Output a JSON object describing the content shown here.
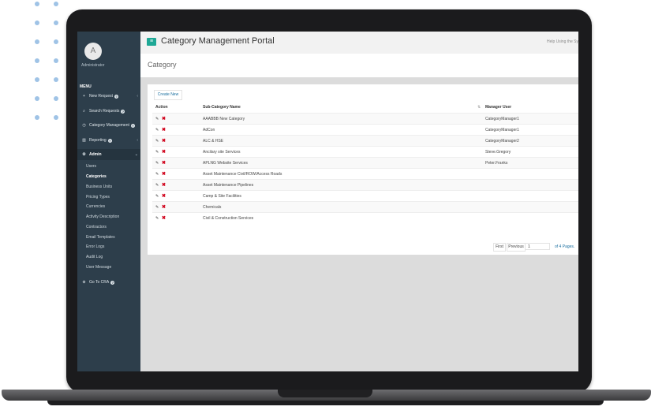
{
  "sidebar": {
    "avatar_letter": "A",
    "user_name": "Administrator",
    "menu_label": "MENU",
    "items": [
      {
        "icon": "plus-icon",
        "glyph": "+",
        "label": "New Request",
        "chevron": "‹"
      },
      {
        "icon": "search-icon",
        "glyph": "⌕",
        "label": "Search Requests",
        "chevron": ""
      },
      {
        "icon": "clock-icon",
        "glyph": "◷",
        "label": "Category Management",
        "chevron": ""
      },
      {
        "icon": "chart-icon",
        "glyph": "▥",
        "label": "Reporting",
        "chevron": "‹"
      },
      {
        "icon": "cogs-icon",
        "glyph": "⚙",
        "label": "Admin",
        "chevron": "⌄"
      }
    ],
    "admin_sub_items": [
      "Users",
      "Categories",
      "Business Units",
      "Pricing Types",
      "Currencies",
      "Activity Description",
      "Contractors",
      "Email Templates",
      "Error Logs",
      "Audit Log",
      "User Message"
    ],
    "go_to_cra": {
      "glyph": "⊕",
      "label": "Go To CRA"
    },
    "help_glyph": "?"
  },
  "topbar": {
    "menu_glyph": "≡",
    "title": "Category Management Portal",
    "help_text": "Help Using the Sy"
  },
  "page": {
    "title": "Category"
  },
  "table": {
    "create_label": "Create New",
    "headers": {
      "action": "Action",
      "sub_category": "Sub-Category Name",
      "manager": "Manager User"
    },
    "sort_glyph": "⇅",
    "edit_glyph": "✎",
    "delete_glyph": "✖",
    "rows": [
      {
        "name": "AAABBB New Category",
        "manager": "CategoryManager1"
      },
      {
        "name": "AdCon",
        "manager": "CategoryManager1"
      },
      {
        "name": "ALC & HSE",
        "manager": "CategoryManager2"
      },
      {
        "name": "Ancilary site Services",
        "manager": "Steve.Gregory"
      },
      {
        "name": "APLNG Website Services",
        "manager": "Peter.Franks"
      },
      {
        "name": "Asset Maintenance Civil/ROW/Access Roads",
        "manager": ""
      },
      {
        "name": "Asset Maintenance Pipelines",
        "manager": ""
      },
      {
        "name": "Camp & Site Facilities",
        "manager": ""
      },
      {
        "name": "Chemicals",
        "manager": ""
      },
      {
        "name": "Civil & Construction Services",
        "manager": ""
      }
    ]
  },
  "pagination": {
    "first_label": "First",
    "previous_label": "Previous",
    "page_value": "1",
    "of_pages": "of 4 Pages."
  },
  "colors": {
    "sidebar_bg": "#2d3e4b",
    "accent": "#1fa896",
    "delete_red": "#d0021b",
    "link_blue": "#1a6fa0"
  }
}
